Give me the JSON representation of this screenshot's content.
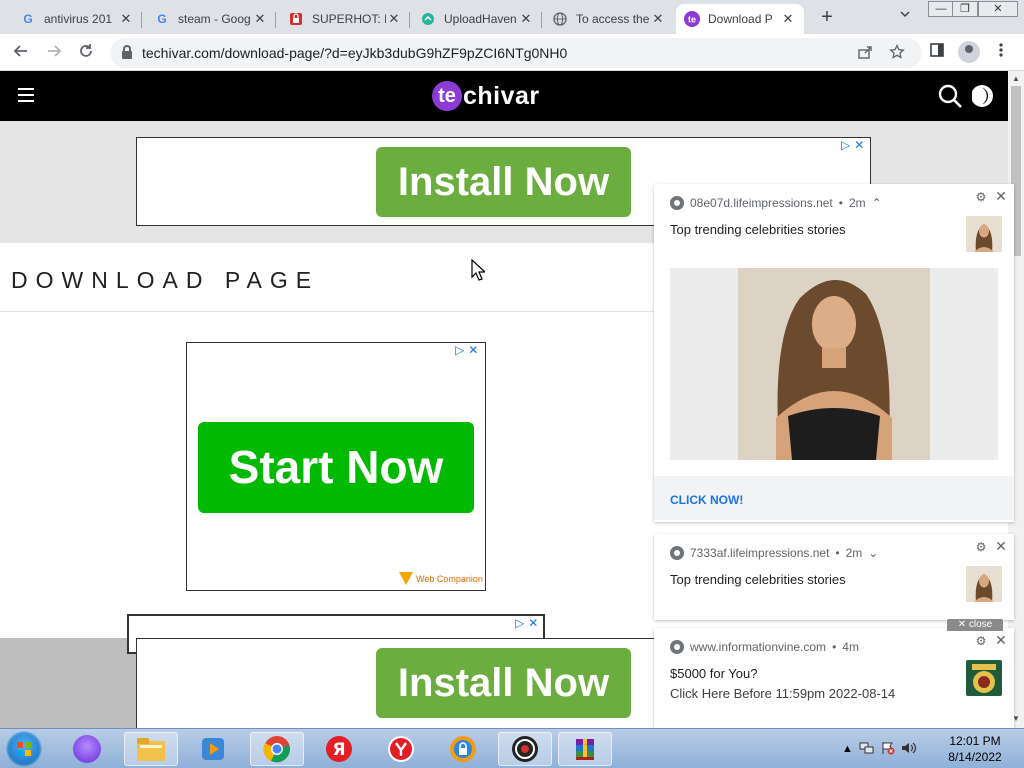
{
  "browser": {
    "tabs": [
      {
        "title": "antivirus 201",
        "favicon": "google-g-icon",
        "active": false
      },
      {
        "title": "steam - Goog",
        "favicon": "google-g-icon",
        "active": false
      },
      {
        "title": "SUPERHOT: I",
        "favicon": "superhot-icon",
        "active": false
      },
      {
        "title": "UploadHaven",
        "favicon": "uploadhaven-icon",
        "active": false
      },
      {
        "title": "To access the",
        "favicon": "globe-icon",
        "active": false
      },
      {
        "title": "Download P",
        "favicon": "techivar-icon",
        "active": true
      }
    ],
    "close_glyph": "✕",
    "new_tab_glyph": "+",
    "url": "techivar.com/download-page/?d=eyJkb3dubG9hZF9pZCI6NTg0NH0",
    "window_buttons": [
      "—",
      "❐",
      "✕"
    ]
  },
  "site": {
    "logo_mark": "te",
    "logo_rest": "chivar",
    "page_title": "DOWNLOAD PAGE"
  },
  "ads": {
    "install_label": "Install Now",
    "start_label": "Start Now",
    "webcompanion_label": "Web Companion",
    "adchoices_glyph": "▷",
    "ad_close_glyph": "✕"
  },
  "notifications": [
    {
      "origin": "08e07d.lifeimpressions.net",
      "time": "2m",
      "chevron": "⌃",
      "title": "Top trending celebrities stories",
      "action": "CLICK NOW!"
    },
    {
      "origin": "7333af.lifeimpressions.net",
      "time": "2m",
      "chevron": "⌄",
      "title": "Top trending celebrities stories"
    },
    {
      "origin": "www.informationvine.com",
      "time": "4m",
      "title": "$5000 for You?",
      "body": "Click Here Before 11:59pm 2022-08-14"
    }
  ],
  "notif_separator": "•",
  "close_pill_label": "✕ close",
  "taskbar": {
    "clock_time": "12:01 PM",
    "clock_date": "8/14/2022"
  },
  "colors": {
    "install_green": "#6cad3f",
    "start_green": "#02b902",
    "logo_purple": "#8e3bd6",
    "link_blue": "#1a73e8"
  }
}
